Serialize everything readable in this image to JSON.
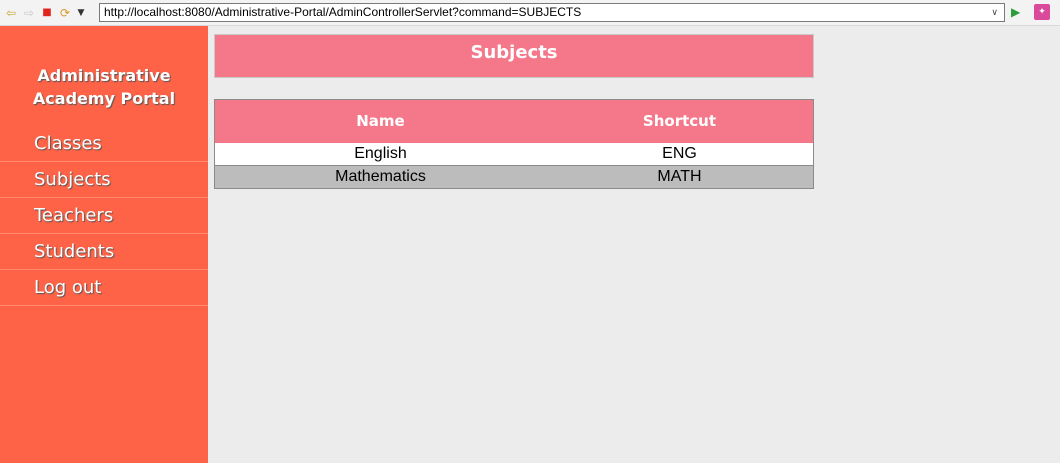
{
  "browser": {
    "url": "http://localhost:8080/Administrative-Portal/AdminControllerServlet?command=SUBJECTS",
    "icons": {
      "back": "back-arrow-icon",
      "forward": "forward-arrow-icon",
      "stop": "stop-icon",
      "refresh": "refresh-icon",
      "menu": "chevron-down-icon",
      "go": "go-icon",
      "extension": "extension-icon"
    }
  },
  "sidebar": {
    "title_line1": "Administrative",
    "title_line2": "Academy Portal",
    "items": [
      {
        "label": "Classes"
      },
      {
        "label": "Subjects"
      },
      {
        "label": "Teachers"
      },
      {
        "label": "Students"
      },
      {
        "label": "Log out"
      }
    ]
  },
  "main": {
    "title": "Subjects",
    "table": {
      "headers": [
        "Name",
        "Shortcut"
      ],
      "rows": [
        {
          "name": "English",
          "shortcut": "ENG"
        },
        {
          "name": "Mathematics",
          "shortcut": "MATH"
        }
      ]
    }
  },
  "colors": {
    "sidebar": "#ff6347",
    "header": "#f4788a",
    "alt_row": "#bcbcbc"
  }
}
